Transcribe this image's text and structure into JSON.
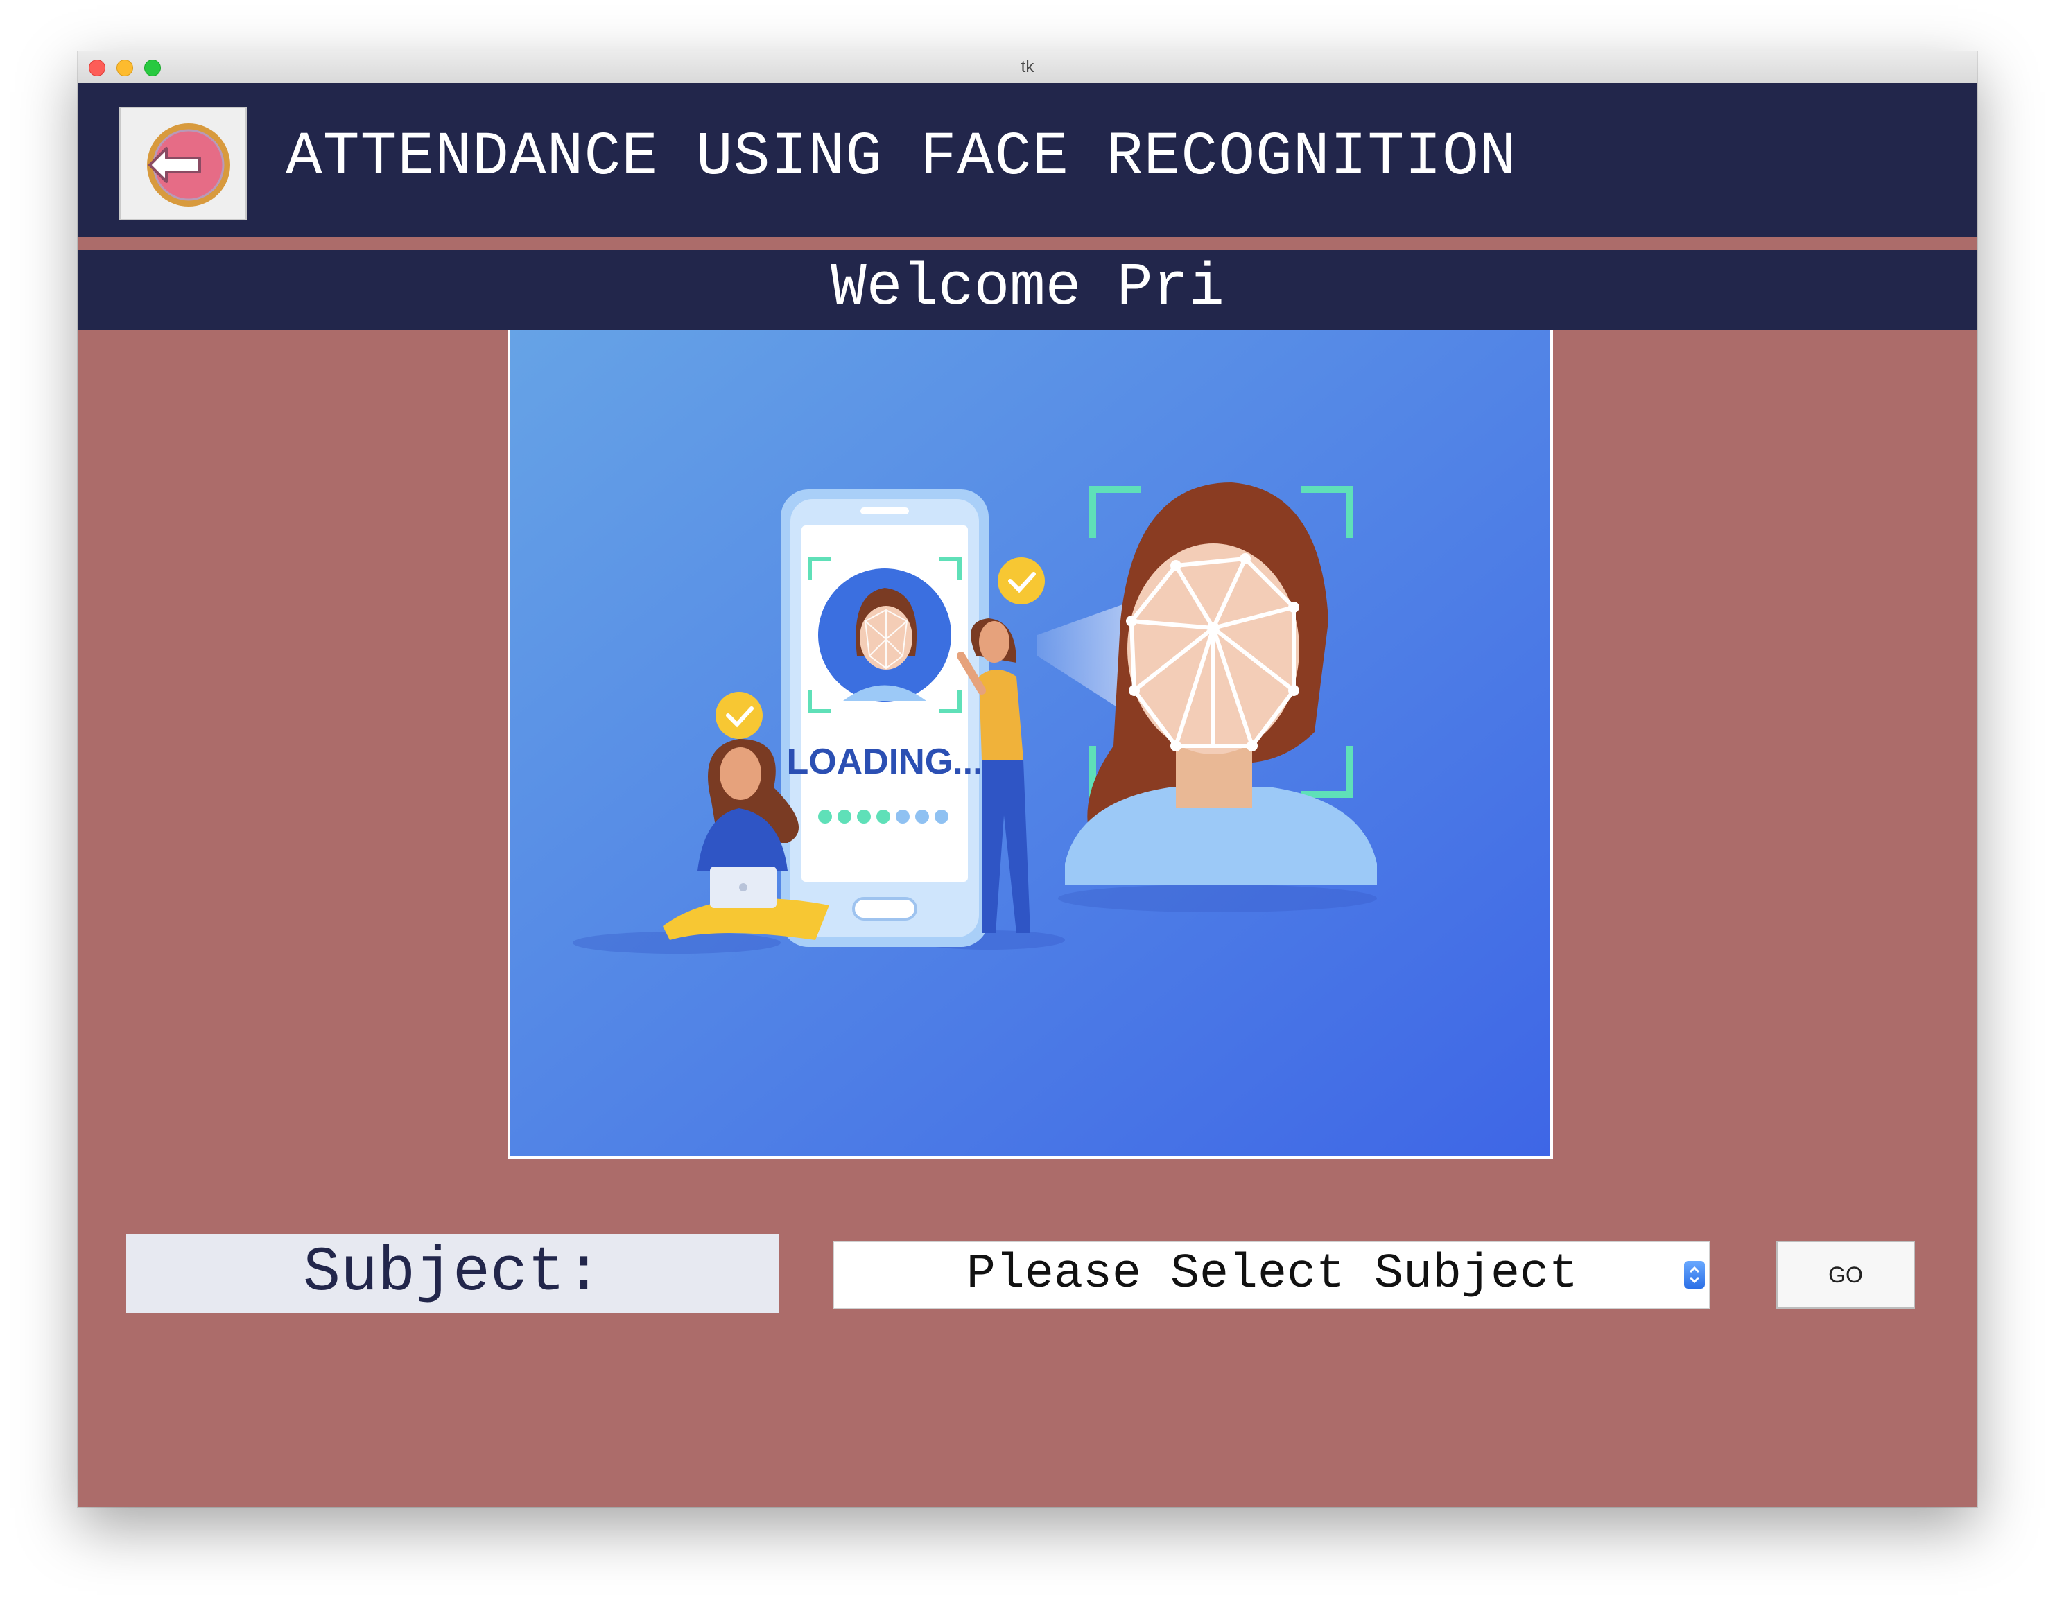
{
  "window": {
    "title": "tk"
  },
  "header": {
    "title": "ATTENDANCE USING FACE RECOGNITION",
    "back_icon": "logout-arrow-icon"
  },
  "welcome": {
    "text": "Welcome Pri"
  },
  "hero": {
    "loading_text": "LOADING..."
  },
  "form": {
    "subject_label": "Subject:",
    "subject_select_value": "Please Select Subject",
    "go_label": "GO"
  },
  "colors": {
    "navy": "#22264b",
    "rose": "#ac6c6a",
    "hero_blue": "#4a7fe6",
    "accent_green": "#5fe0b8",
    "accent_yellow": "#f7c733"
  }
}
